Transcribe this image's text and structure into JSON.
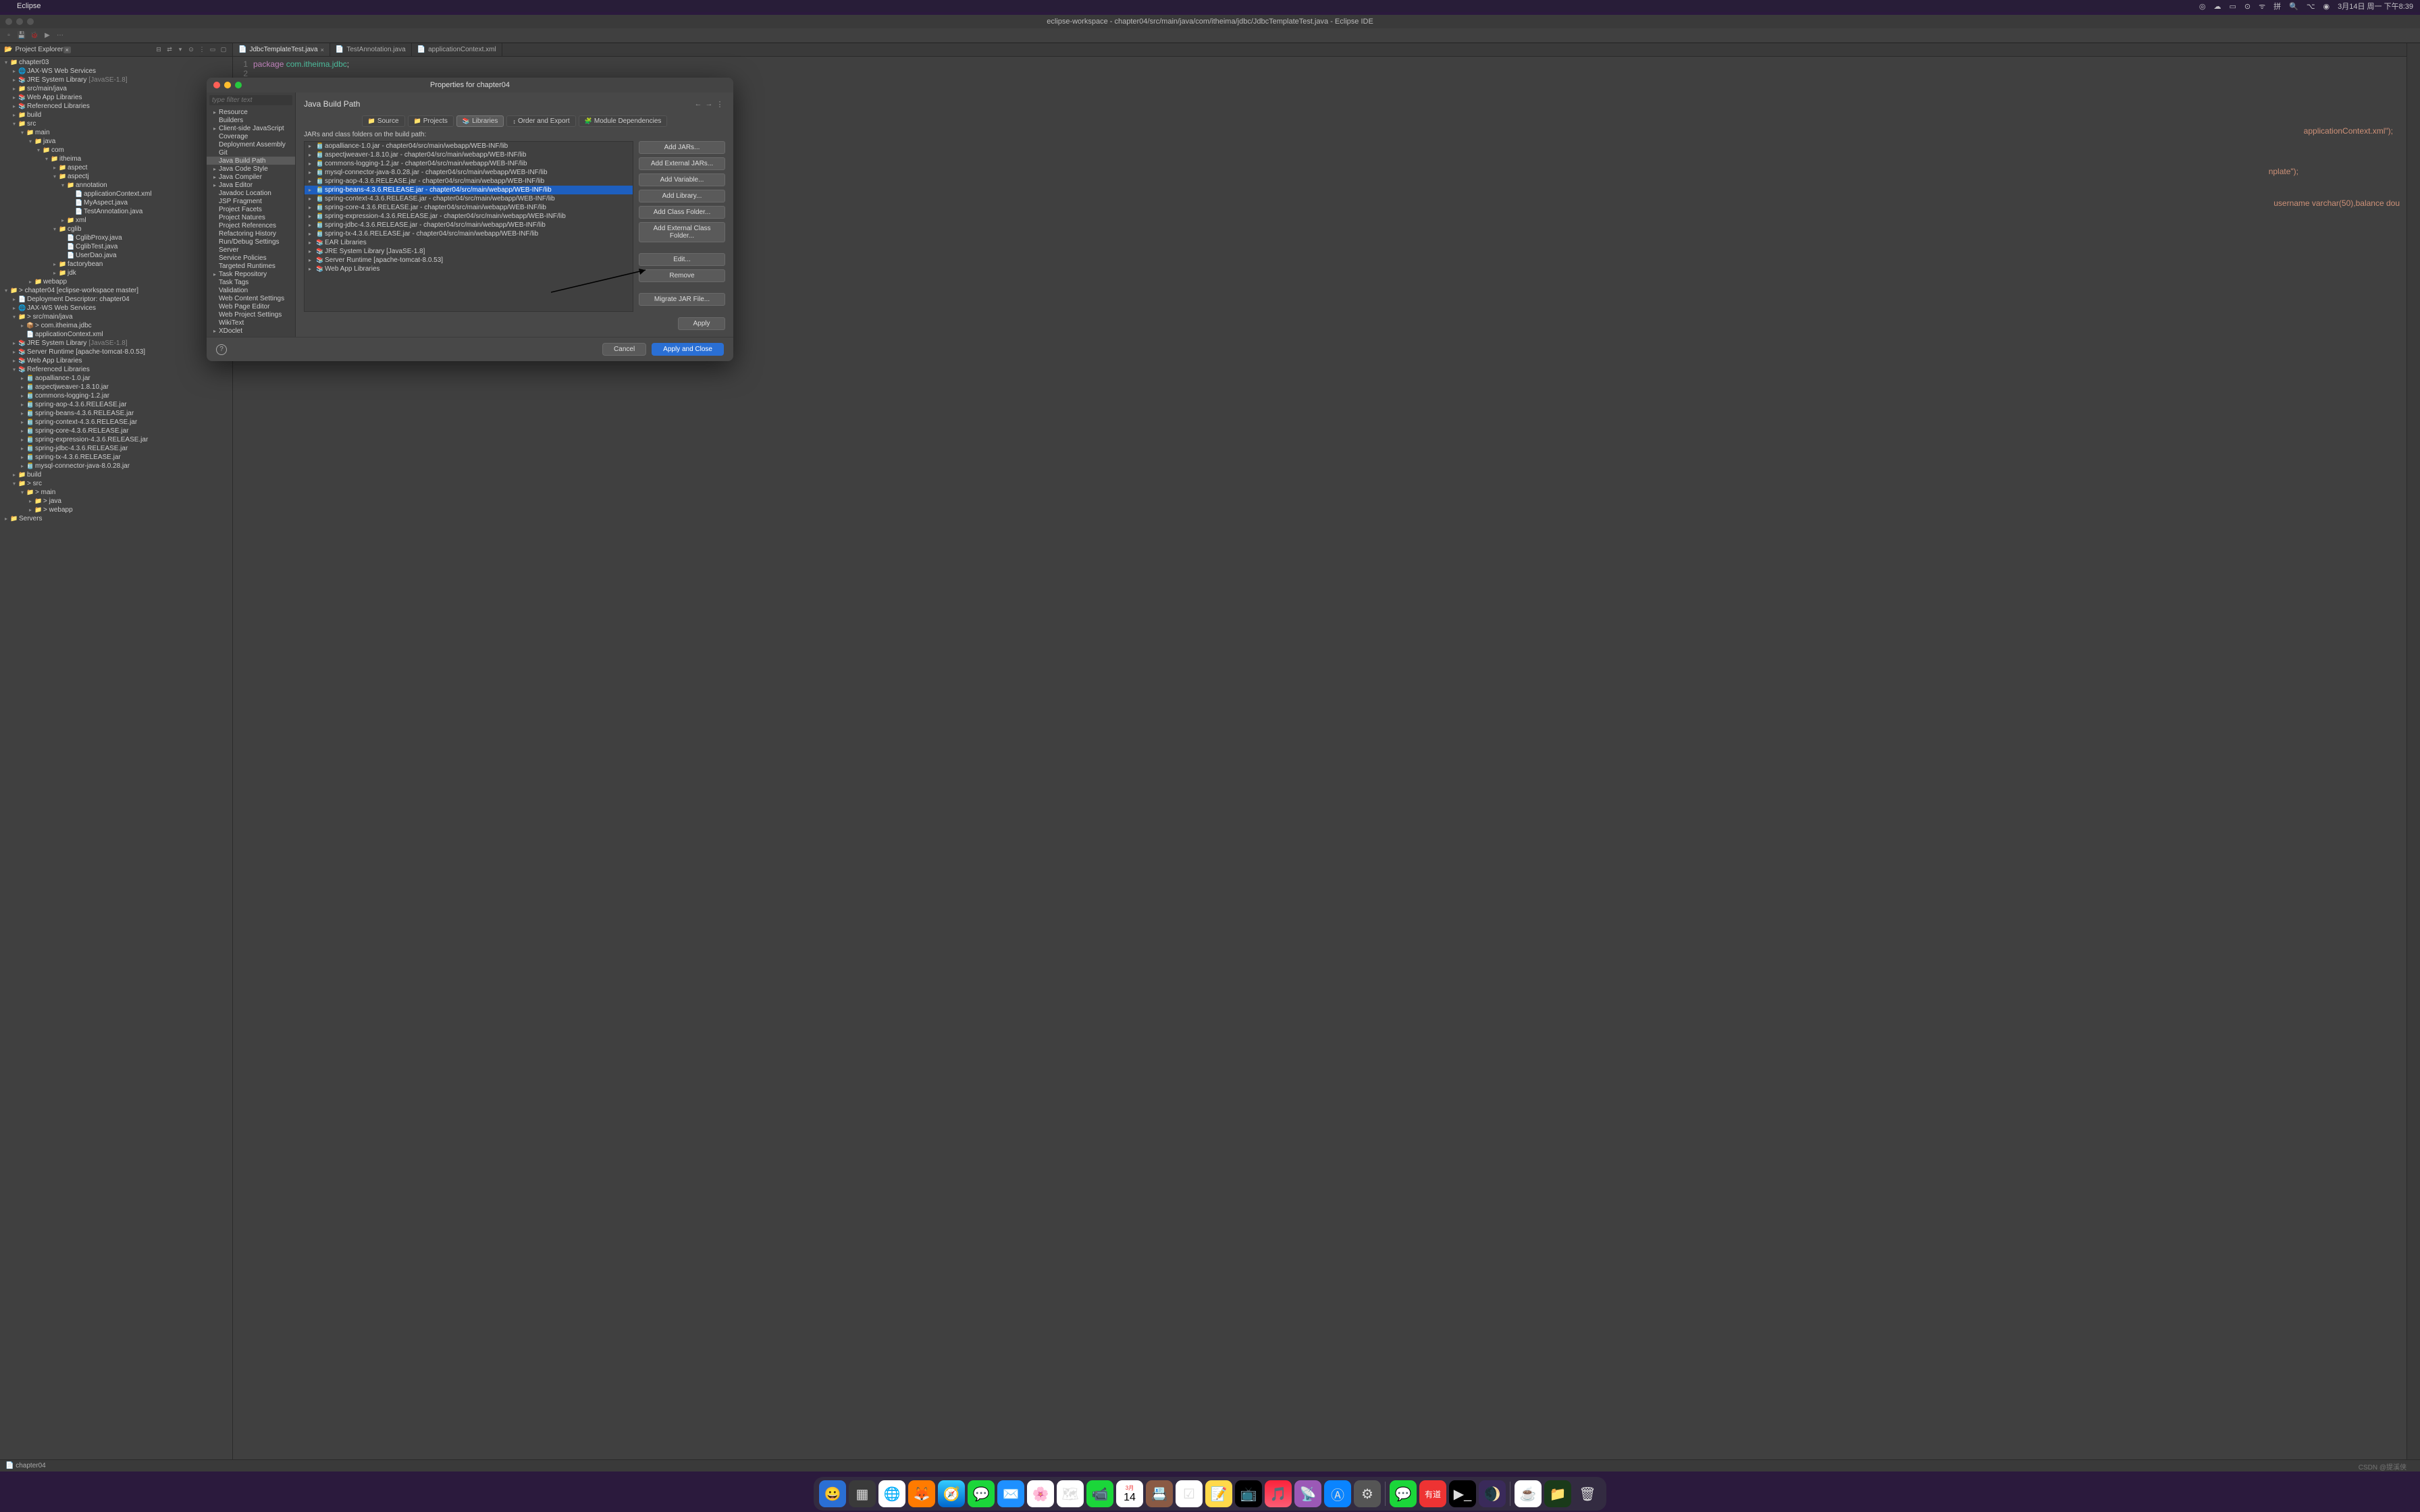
{
  "mac": {
    "app": "Eclipse",
    "date": "3月14日 周一 下午8:39"
  },
  "ide": {
    "title": "eclipse-workspace - chapter04/src/main/java/com/itheima/jdbc/JdbcTemplateTest.java - Eclipse IDE"
  },
  "explorer": {
    "title": "Project Explorer",
    "tree": [
      {
        "depth": 0,
        "exp": "▾",
        "icon": "📁",
        "label": "chapter03",
        "cls": "icon-proj"
      },
      {
        "depth": 1,
        "exp": "▸",
        "icon": "🌐",
        "label": "JAX-WS Web Services"
      },
      {
        "depth": 1,
        "exp": "▸",
        "icon": "📚",
        "label": "JRE System Library",
        "suffix": "[JavaSE-1.8]",
        "cls": "icon-jar"
      },
      {
        "depth": 1,
        "exp": "▸",
        "icon": "📁",
        "label": "src/main/java",
        "cls": "icon-pkg"
      },
      {
        "depth": 1,
        "exp": "▸",
        "icon": "📚",
        "label": "Web App Libraries",
        "cls": "icon-jar"
      },
      {
        "depth": 1,
        "exp": "▸",
        "icon": "📚",
        "label": "Referenced Libraries",
        "cls": "icon-jar"
      },
      {
        "depth": 1,
        "exp": "▸",
        "icon": "📁",
        "label": "build",
        "cls": "icon-folder"
      },
      {
        "depth": 1,
        "exp": "▾",
        "icon": "📁",
        "label": "src",
        "cls": "icon-folder"
      },
      {
        "depth": 2,
        "exp": "▾",
        "icon": "📁",
        "label": "main",
        "cls": "icon-folder"
      },
      {
        "depth": 3,
        "exp": "▾",
        "icon": "📁",
        "label": "java",
        "cls": "icon-folder"
      },
      {
        "depth": 4,
        "exp": "▾",
        "icon": "📁",
        "label": "com",
        "cls": "icon-folder"
      },
      {
        "depth": 5,
        "exp": "▾",
        "icon": "📁",
        "label": "itheima",
        "cls": "icon-folder"
      },
      {
        "depth": 6,
        "exp": "▸",
        "icon": "📁",
        "label": "aspect",
        "cls": "icon-folder"
      },
      {
        "depth": 6,
        "exp": "▾",
        "icon": "📁",
        "label": "aspectj",
        "cls": "icon-folder"
      },
      {
        "depth": 7,
        "exp": "▾",
        "icon": "📁",
        "label": "annotation",
        "cls": "icon-folder"
      },
      {
        "depth": 8,
        "exp": "",
        "icon": "📄",
        "label": "applicationContext.xml",
        "cls": "icon-xml"
      },
      {
        "depth": 8,
        "exp": "",
        "icon": "📄",
        "label": "MyAspect.java",
        "cls": "icon-java"
      },
      {
        "depth": 8,
        "exp": "",
        "icon": "📄",
        "label": "TestAnnotation.java",
        "cls": "icon-java"
      },
      {
        "depth": 7,
        "exp": "▸",
        "icon": "📁",
        "label": "xml",
        "cls": "icon-folder"
      },
      {
        "depth": 6,
        "exp": "▾",
        "icon": "📁",
        "label": "cglib",
        "cls": "icon-folder"
      },
      {
        "depth": 7,
        "exp": "",
        "icon": "📄",
        "label": "CglibProxy.java",
        "cls": "icon-java"
      },
      {
        "depth": 7,
        "exp": "",
        "icon": "📄",
        "label": "CglibTest.java",
        "cls": "icon-java"
      },
      {
        "depth": 7,
        "exp": "",
        "icon": "📄",
        "label": "UserDao.java",
        "cls": "icon-java"
      },
      {
        "depth": 6,
        "exp": "▸",
        "icon": "📁",
        "label": "factorybean",
        "cls": "icon-folder"
      },
      {
        "depth": 6,
        "exp": "▸",
        "icon": "📁",
        "label": "jdk",
        "cls": "icon-folder"
      },
      {
        "depth": 3,
        "exp": "▸",
        "icon": "📁",
        "label": "webapp",
        "cls": "icon-folder"
      },
      {
        "depth": 0,
        "exp": "▾",
        "icon": "📁",
        "label": "> chapter04 [eclipse-workspace master]",
        "cls": "icon-proj"
      },
      {
        "depth": 1,
        "exp": "▸",
        "icon": "📄",
        "label": "Deployment Descriptor: chapter04"
      },
      {
        "depth": 1,
        "exp": "▸",
        "icon": "🌐",
        "label": "JAX-WS Web Services"
      },
      {
        "depth": 1,
        "exp": "▾",
        "icon": "📁",
        "label": "> src/main/java",
        "cls": "icon-pkg"
      },
      {
        "depth": 2,
        "exp": "▸",
        "icon": "📦",
        "label": "> com.itheima.jdbc",
        "cls": "icon-pkg"
      },
      {
        "depth": 2,
        "exp": "",
        "icon": "📄",
        "label": "applicationContext.xml",
        "cls": "icon-xml"
      },
      {
        "depth": 1,
        "exp": "▸",
        "icon": "📚",
        "label": "JRE System Library",
        "suffix": "[JavaSE-1.8]",
        "cls": "icon-jar"
      },
      {
        "depth": 1,
        "exp": "▸",
        "icon": "📚",
        "label": "Server Runtime [apache-tomcat-8.0.53]",
        "cls": "icon-jar"
      },
      {
        "depth": 1,
        "exp": "▸",
        "icon": "📚",
        "label": "Web App Libraries",
        "cls": "icon-jar"
      },
      {
        "depth": 1,
        "exp": "▾",
        "icon": "📚",
        "label": "Referenced Libraries",
        "cls": "icon-jar"
      },
      {
        "depth": 2,
        "exp": "▸",
        "icon": "🫙",
        "label": "aopalliance-1.0.jar",
        "cls": "icon-jar"
      },
      {
        "depth": 2,
        "exp": "▸",
        "icon": "🫙",
        "label": "aspectjweaver-1.8.10.jar",
        "cls": "icon-jar"
      },
      {
        "depth": 2,
        "exp": "▸",
        "icon": "🫙",
        "label": "commons-logging-1.2.jar",
        "cls": "icon-jar"
      },
      {
        "depth": 2,
        "exp": "▸",
        "icon": "🫙",
        "label": "spring-aop-4.3.6.RELEASE.jar",
        "cls": "icon-jar"
      },
      {
        "depth": 2,
        "exp": "▸",
        "icon": "🫙",
        "label": "spring-beans-4.3.6.RELEASE.jar",
        "cls": "icon-jar"
      },
      {
        "depth": 2,
        "exp": "▸",
        "icon": "🫙",
        "label": "spring-context-4.3.6.RELEASE.jar",
        "cls": "icon-jar"
      },
      {
        "depth": 2,
        "exp": "▸",
        "icon": "🫙",
        "label": "spring-core-4.3.6.RELEASE.jar",
        "cls": "icon-jar"
      },
      {
        "depth": 2,
        "exp": "▸",
        "icon": "🫙",
        "label": "spring-expression-4.3.6.RELEASE.jar",
        "cls": "icon-jar"
      },
      {
        "depth": 2,
        "exp": "▸",
        "icon": "🫙",
        "label": "spring-jdbc-4.3.6.RELEASE.jar",
        "cls": "icon-jar"
      },
      {
        "depth": 2,
        "exp": "▸",
        "icon": "🫙",
        "label": "spring-tx-4.3.6.RELEASE.jar",
        "cls": "icon-jar"
      },
      {
        "depth": 2,
        "exp": "▸",
        "icon": "🫙",
        "label": "mysql-connector-java-8.0.28.jar",
        "cls": "icon-jar"
      },
      {
        "depth": 1,
        "exp": "▸",
        "icon": "📁",
        "label": "build",
        "cls": "icon-folder"
      },
      {
        "depth": 1,
        "exp": "▾",
        "icon": "📁",
        "label": "> src",
        "cls": "icon-folder"
      },
      {
        "depth": 2,
        "exp": "▾",
        "icon": "📁",
        "label": "> main",
        "cls": "icon-folder"
      },
      {
        "depth": 3,
        "exp": "▸",
        "icon": "📁",
        "label": "> java",
        "cls": "icon-folder"
      },
      {
        "depth": 3,
        "exp": "▸",
        "icon": "📁",
        "label": "> webapp",
        "cls": "icon-folder"
      },
      {
        "depth": 0,
        "exp": "▸",
        "icon": "📁",
        "label": "Servers",
        "cls": "icon-folder"
      }
    ]
  },
  "editor": {
    "tabs": [
      {
        "label": "JdbcTemplateTest.java",
        "active": true
      },
      {
        "label": "TestAnnotation.java",
        "active": false
      },
      {
        "label": "applicationContext.xml",
        "active": false
      }
    ],
    "visible_code_fragments": {
      "line1": "package com.itheima.jdbc;",
      "frag_ctx": "applicationContext.xml\");",
      "frag_tpl": "nplate\");",
      "frag_sql": "username varchar(50),balance dou"
    }
  },
  "breadcrumb": "chapter04",
  "dialog": {
    "title": "Properties for chapter04",
    "filter_placeholder": "type filter text",
    "categories": [
      {
        "label": "Resource",
        "exp": "▸"
      },
      {
        "label": "Builders",
        "exp": ""
      },
      {
        "label": "Client-side JavaScript",
        "exp": "▸"
      },
      {
        "label": "Coverage",
        "exp": ""
      },
      {
        "label": "Deployment Assembly",
        "exp": ""
      },
      {
        "label": "Git",
        "exp": ""
      },
      {
        "label": "Java Build Path",
        "exp": "",
        "selected": true
      },
      {
        "label": "Java Code Style",
        "exp": "▸"
      },
      {
        "label": "Java Compiler",
        "exp": "▸"
      },
      {
        "label": "Java Editor",
        "exp": "▸"
      },
      {
        "label": "Javadoc Location",
        "exp": ""
      },
      {
        "label": "JSP Fragment",
        "exp": ""
      },
      {
        "label": "Project Facets",
        "exp": ""
      },
      {
        "label": "Project Natures",
        "exp": ""
      },
      {
        "label": "Project References",
        "exp": ""
      },
      {
        "label": "Refactoring History",
        "exp": ""
      },
      {
        "label": "Run/Debug Settings",
        "exp": ""
      },
      {
        "label": "Server",
        "exp": ""
      },
      {
        "label": "Service Policies",
        "exp": ""
      },
      {
        "label": "Targeted Runtimes",
        "exp": ""
      },
      {
        "label": "Task Repository",
        "exp": "▸"
      },
      {
        "label": "Task Tags",
        "exp": ""
      },
      {
        "label": "Validation",
        "exp": ""
      },
      {
        "label": "Web Content Settings",
        "exp": ""
      },
      {
        "label": "Web Page Editor",
        "exp": ""
      },
      {
        "label": "Web Project Settings",
        "exp": ""
      },
      {
        "label": "WikiText",
        "exp": ""
      },
      {
        "label": "XDoclet",
        "exp": "▸"
      }
    ],
    "page_title": "Java Build Path",
    "tabs": [
      {
        "icon": "📁",
        "label": "Source"
      },
      {
        "icon": "📁",
        "label": "Projects"
      },
      {
        "icon": "📚",
        "label": "Libraries",
        "active": true
      },
      {
        "icon": "↕",
        "label": "Order and Export"
      },
      {
        "icon": "🧩",
        "label": "Module Dependencies"
      }
    ],
    "jars_label": "JARs and class folders on the build path:",
    "jars": [
      {
        "icon": "🫙",
        "label": "aopalliance-1.0.jar - chapter04/src/main/webapp/WEB-INF/lib"
      },
      {
        "icon": "🫙",
        "label": "aspectjweaver-1.8.10.jar - chapter04/src/main/webapp/WEB-INF/lib"
      },
      {
        "icon": "🫙",
        "label": "commons-logging-1.2.jar - chapter04/src/main/webapp/WEB-INF/lib"
      },
      {
        "icon": "🫙",
        "label": "mysql-connector-java-8.0.28.jar - chapter04/src/main/webapp/WEB-INF/lib"
      },
      {
        "icon": "🫙",
        "label": "spring-aop-4.3.6.RELEASE.jar - chapter04/src/main/webapp/WEB-INF/lib"
      },
      {
        "icon": "🫙",
        "label": "spring-beans-4.3.6.RELEASE.jar - chapter04/src/main/webapp/WEB-INF/lib",
        "selected": true
      },
      {
        "icon": "🫙",
        "label": "spring-context-4.3.6.RELEASE.jar - chapter04/src/main/webapp/WEB-INF/lib"
      },
      {
        "icon": "🫙",
        "label": "spring-core-4.3.6.RELEASE.jar - chapter04/src/main/webapp/WEB-INF/lib"
      },
      {
        "icon": "🫙",
        "label": "spring-expression-4.3.6.RELEASE.jar - chapter04/src/main/webapp/WEB-INF/lib"
      },
      {
        "icon": "🫙",
        "label": "spring-jdbc-4.3.6.RELEASE.jar - chapter04/src/main/webapp/WEB-INF/lib"
      },
      {
        "icon": "🫙",
        "label": "spring-tx-4.3.6.RELEASE.jar - chapter04/src/main/webapp/WEB-INF/lib"
      },
      {
        "icon": "📚",
        "label": "EAR Libraries"
      },
      {
        "icon": "📚",
        "label": "JRE System Library [JavaSE-1.8]"
      },
      {
        "icon": "📚",
        "label": "Server Runtime [apache-tomcat-8.0.53]"
      },
      {
        "icon": "📚",
        "label": "Web App Libraries"
      }
    ],
    "buttons": {
      "add_jars": "Add JARs...",
      "add_ext_jars": "Add External JARs...",
      "add_var": "Add Variable...",
      "add_lib": "Add Library...",
      "add_class": "Add Class Folder...",
      "add_ext_class": "Add External Class Folder...",
      "edit": "Edit...",
      "remove": "Remove",
      "migrate": "Migrate JAR File..."
    },
    "footer": {
      "apply": "Apply",
      "cancel": "Cancel",
      "apply_close": "Apply and Close"
    }
  },
  "watermark": "CSDN @提溪侠"
}
